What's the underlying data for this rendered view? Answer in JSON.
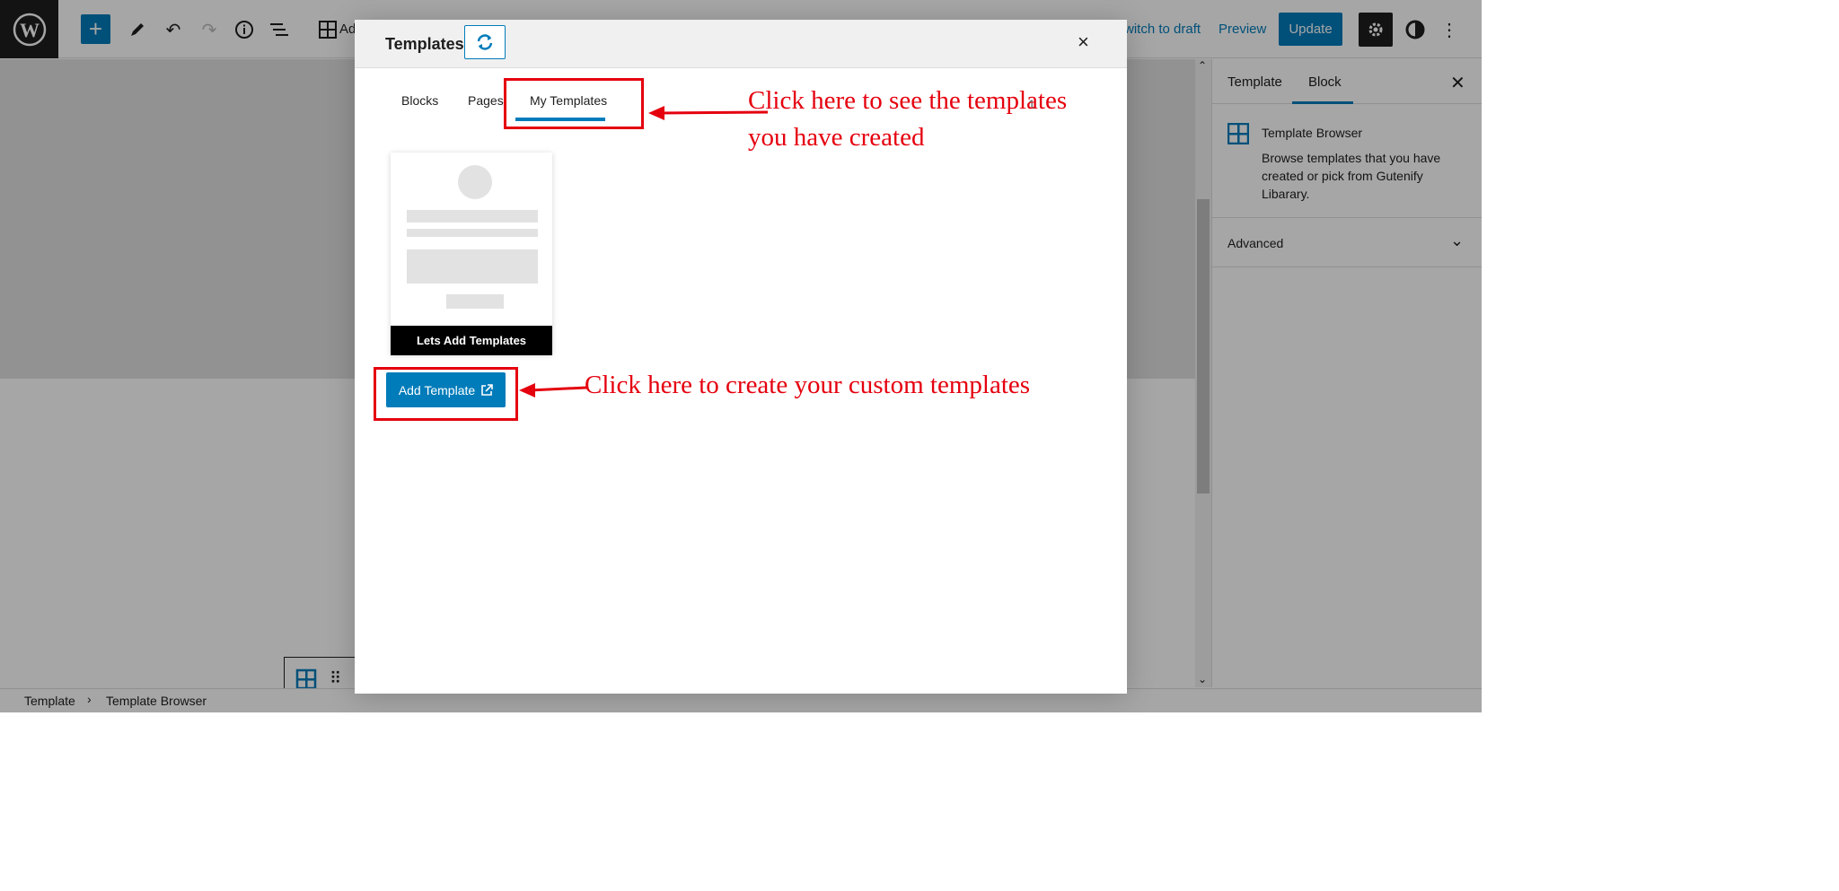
{
  "topbar": {
    "add_partial": "Ad",
    "switch_to_draft": "witch to draft",
    "preview": "Preview",
    "update": "Update"
  },
  "sidebar": {
    "tabs": [
      "Template",
      "Block"
    ],
    "active_tab": "Block",
    "block_title": "Template Browser",
    "block_description": "Browse templates that you have created or pick from Gutenify Libarary.",
    "advanced_label": "Advanced"
  },
  "footer": {
    "breadcrumb": [
      "Template",
      "Template Browser"
    ],
    "separator": "›"
  },
  "modal": {
    "title": "Templates",
    "close": "×",
    "tabs": [
      "Blocks",
      "Pages",
      "My Templates"
    ],
    "active_tab": "My Templates",
    "template_count": "1",
    "card_label": "Lets Add Templates",
    "add_template_label": "Add Template"
  },
  "annotations": {
    "tab_note": "Click here to see the templates you have created",
    "button_note": "Click here to create your custom templates",
    "color": "#e5000e"
  },
  "colors": {
    "accent": "#007cba",
    "dark": "#1e1e1e"
  }
}
